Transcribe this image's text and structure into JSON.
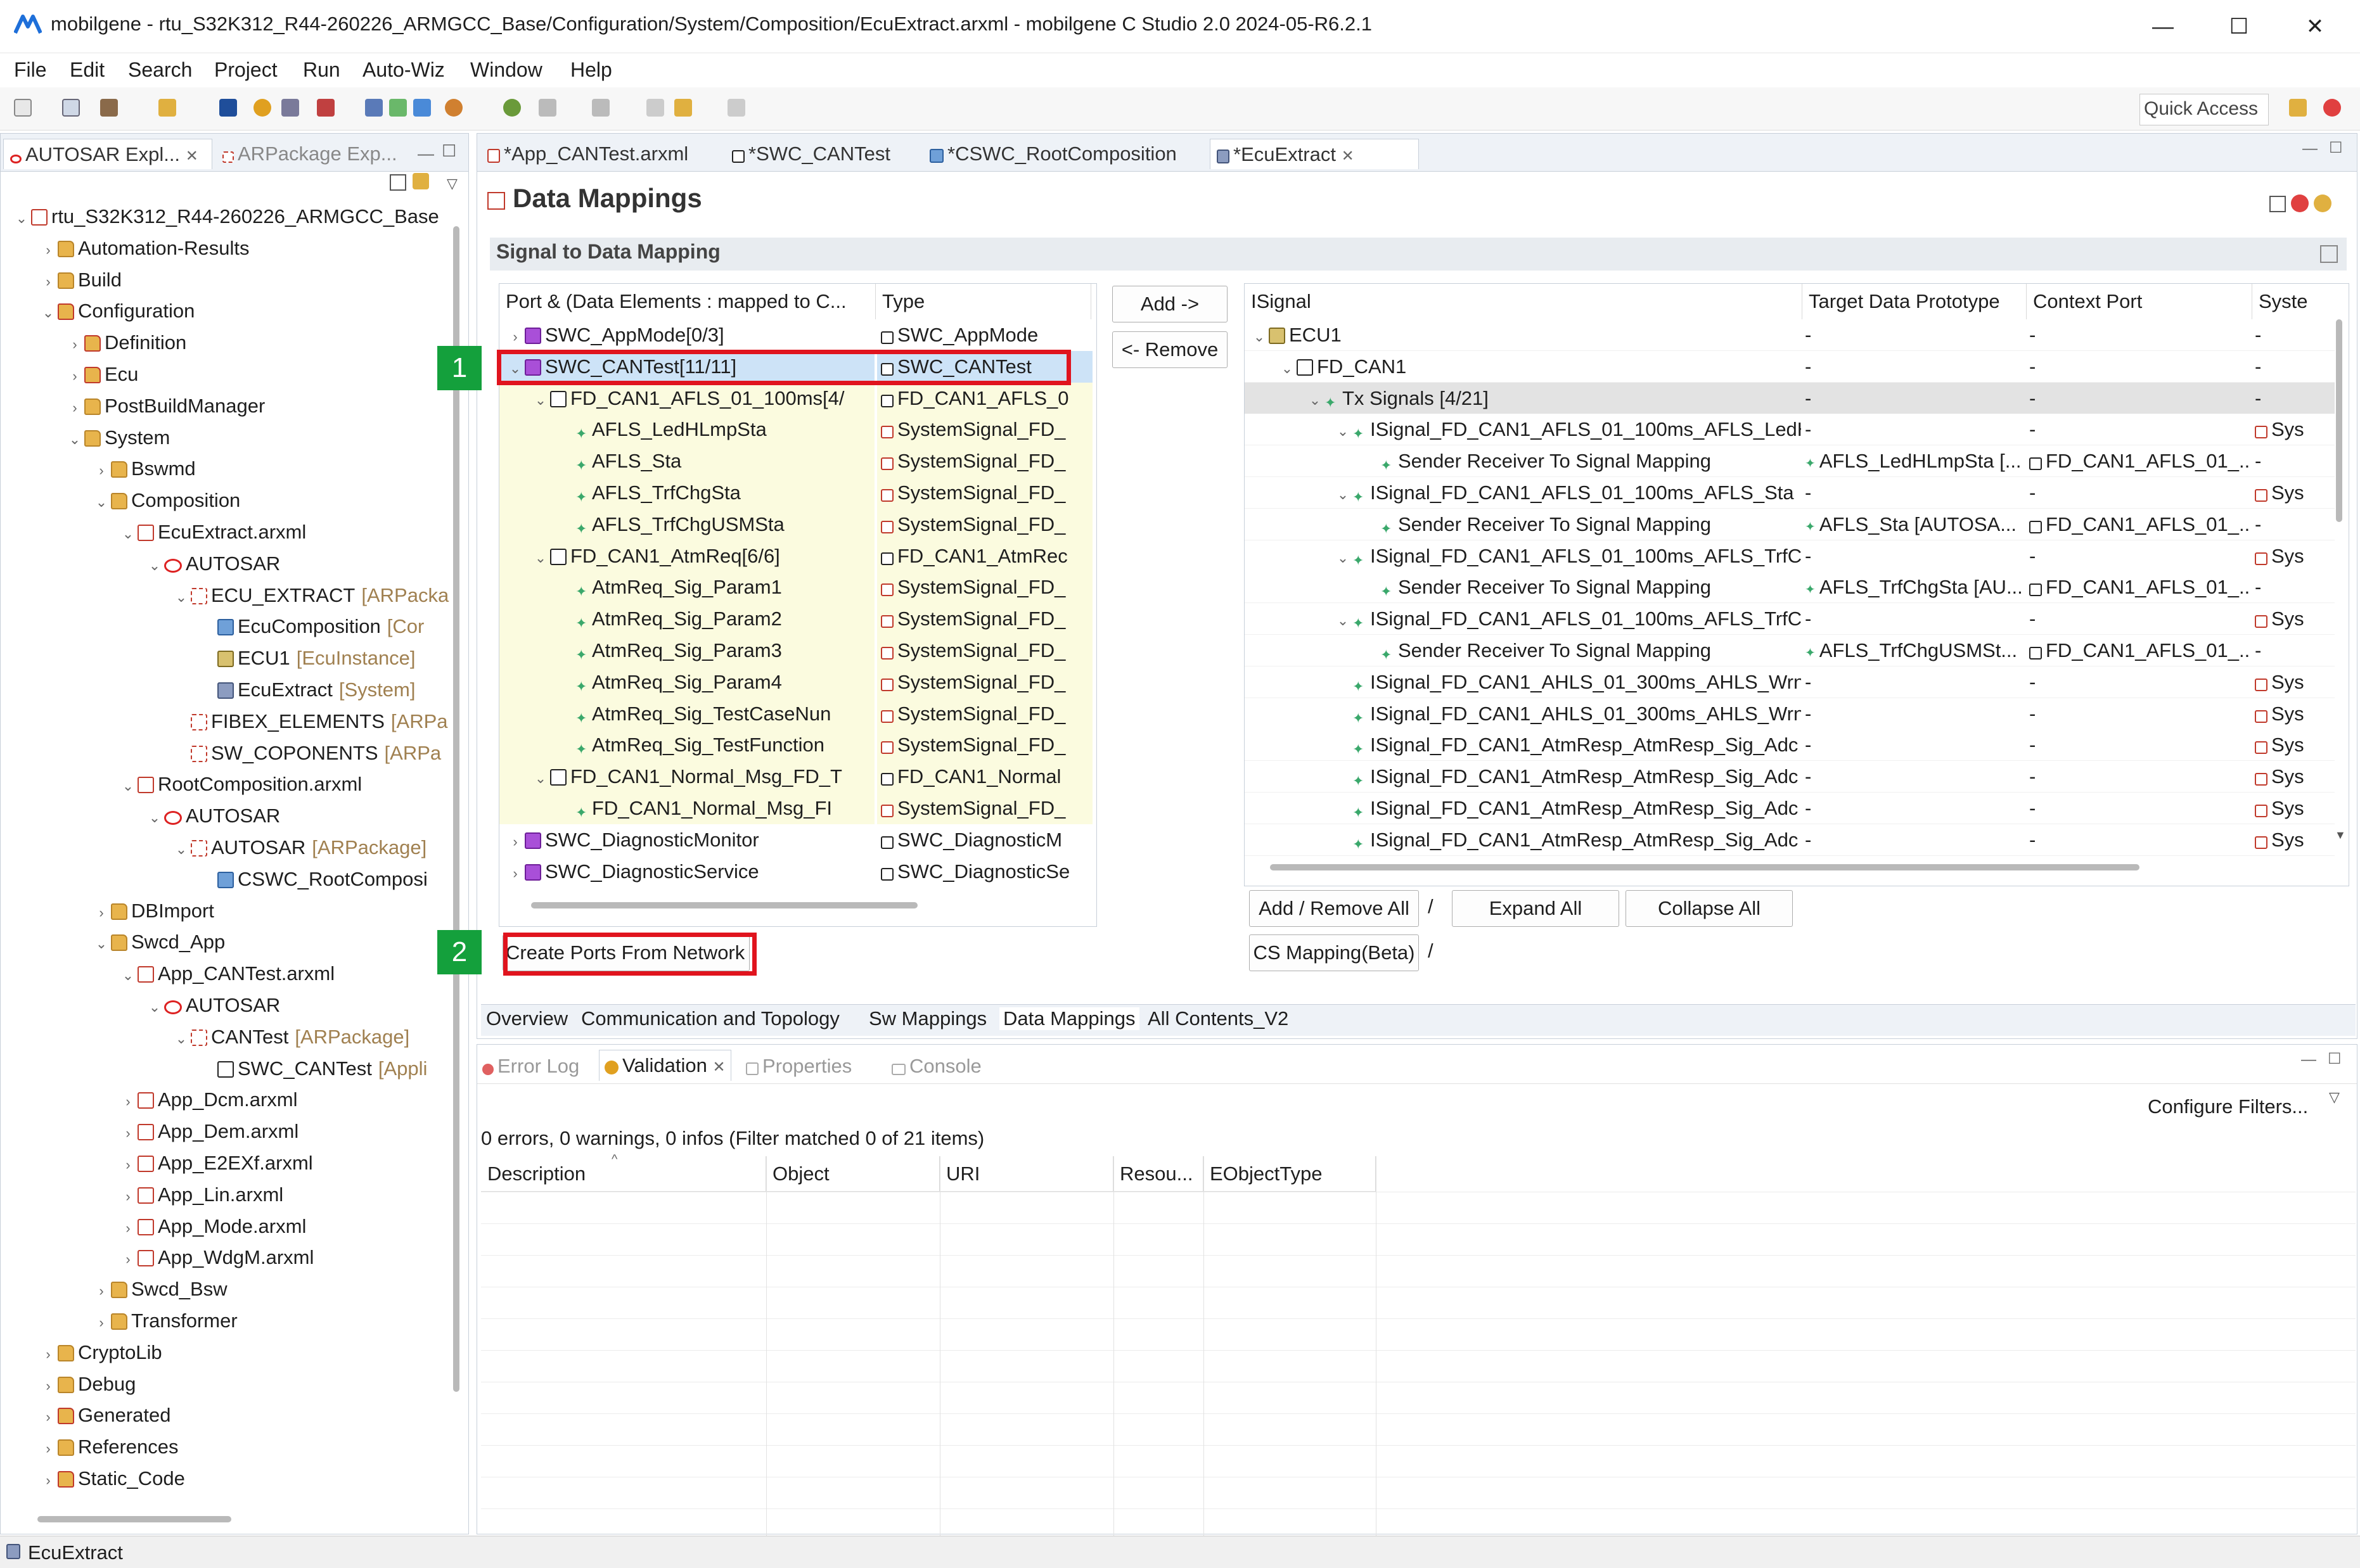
{
  "window": {
    "title": "mobilgene - rtu_S32K312_R44-260226_ARMGCC_Base/Configuration/System/Composition/EcuExtract.arxml - mobilgene C Studio 2.0 2024-05-R6.2.1",
    "minimize": "—",
    "maximize": "☐",
    "close": "✕"
  },
  "menu": [
    "File",
    "Edit",
    "Search",
    "Project",
    "Run",
    "Auto-Wiz",
    "Window",
    "Help"
  ],
  "toolbar": {
    "quick_access": "Quick Access"
  },
  "explorer": {
    "tabs": [
      "AUTOSAR Expl...",
      "ARPackage Exp..."
    ],
    "items": [
      {
        "label": "rtu_S32K312_R44-260226_ARMGCC_Base",
        "suffix": ""
      },
      {
        "label": "Automation-Results",
        "suffix": ""
      },
      {
        "label": "Build",
        "suffix": ""
      },
      {
        "label": "Configuration",
        "suffix": ""
      },
      {
        "label": "Definition",
        "suffix": ""
      },
      {
        "label": "Ecu",
        "suffix": ""
      },
      {
        "label": "PostBuildManager",
        "suffix": ""
      },
      {
        "label": "System",
        "suffix": ""
      },
      {
        "label": "Bswmd",
        "suffix": ""
      },
      {
        "label": "Composition",
        "suffix": ""
      },
      {
        "label": "EcuExtract.arxml",
        "suffix": ""
      },
      {
        "label": "AUTOSAR",
        "suffix": ""
      },
      {
        "label": "ECU_EXTRACT",
        "suffix": "[ARPacka"
      },
      {
        "label": "EcuComposition",
        "suffix": "[Cor"
      },
      {
        "label": "ECU1",
        "suffix": "[EcuInstance]"
      },
      {
        "label": "EcuExtract",
        "suffix": "[System]"
      },
      {
        "label": "FIBEX_ELEMENTS",
        "suffix": "[ARPa"
      },
      {
        "label": "SW_COPONENTS",
        "suffix": "[ARPa"
      },
      {
        "label": "RootComposition.arxml",
        "suffix": ""
      },
      {
        "label": "AUTOSAR",
        "suffix": ""
      },
      {
        "label": "AUTOSAR",
        "suffix": "[ARPackage]"
      },
      {
        "label": "CSWC_RootComposi",
        "suffix": ""
      },
      {
        "label": "DBImport",
        "suffix": ""
      },
      {
        "label": "Swcd_App",
        "suffix": ""
      },
      {
        "label": "App_CANTest.arxml",
        "suffix": ""
      },
      {
        "label": "AUTOSAR",
        "suffix": ""
      },
      {
        "label": "CANTest",
        "suffix": "[ARPackage]"
      },
      {
        "label": "SWC_CANTest",
        "suffix": "[Appli"
      },
      {
        "label": "App_Dcm.arxml",
        "suffix": ""
      },
      {
        "label": "App_Dem.arxml",
        "suffix": ""
      },
      {
        "label": "App_E2EXf.arxml",
        "suffix": ""
      },
      {
        "label": "App_Lin.arxml",
        "suffix": ""
      },
      {
        "label": "App_Mode.arxml",
        "suffix": ""
      },
      {
        "label": "App_WdgM.arxml",
        "suffix": ""
      },
      {
        "label": "Swcd_Bsw",
        "suffix": ""
      },
      {
        "label": "Transformer",
        "suffix": ""
      },
      {
        "label": "CryptoLib",
        "suffix": ""
      },
      {
        "label": "Debug",
        "suffix": ""
      },
      {
        "label": "Generated",
        "suffix": ""
      },
      {
        "label": "References",
        "suffix": ""
      },
      {
        "label": "Static_Code",
        "suffix": ""
      }
    ]
  },
  "editor": {
    "tabs": [
      "*App_CANTest.arxml",
      "*SWC_CANTest",
      "*CSWC_RootComposition",
      "*EcuExtract"
    ],
    "page_title": "Data Mappings",
    "section_title": "Signal to Data Mapping",
    "left_table": {
      "headers": [
        "Port & (Data Elements : mapped to C...",
        "Type"
      ],
      "rows": [
        {
          "name": "SWC_AppMode[0/3]",
          "type": "SWC_AppMode"
        },
        {
          "name": "SWC_CANTest[11/11]",
          "type": "SWC_CANTest"
        },
        {
          "name": "FD_CAN1_AFLS_01_100ms[4/",
          "type": "FD_CAN1_AFLS_0"
        },
        {
          "name": "AFLS_LedHLmpSta",
          "type": "SystemSignal_FD_"
        },
        {
          "name": "AFLS_Sta",
          "type": "SystemSignal_FD_"
        },
        {
          "name": "AFLS_TrfChgSta",
          "type": "SystemSignal_FD_"
        },
        {
          "name": "AFLS_TrfChgUSMSta",
          "type": "SystemSignal_FD_"
        },
        {
          "name": "FD_CAN1_AtmReq[6/6]",
          "type": "FD_CAN1_AtmRec"
        },
        {
          "name": "AtmReq_Sig_Param1",
          "type": "SystemSignal_FD_"
        },
        {
          "name": "AtmReq_Sig_Param2",
          "type": "SystemSignal_FD_"
        },
        {
          "name": "AtmReq_Sig_Param3",
          "type": "SystemSignal_FD_"
        },
        {
          "name": "AtmReq_Sig_Param4",
          "type": "SystemSignal_FD_"
        },
        {
          "name": "AtmReq_Sig_TestCaseNun",
          "type": "SystemSignal_FD_"
        },
        {
          "name": "AtmReq_Sig_TestFunction",
          "type": "SystemSignal_FD_"
        },
        {
          "name": "FD_CAN1_Normal_Msg_FD_T",
          "type": "FD_CAN1_Normal"
        },
        {
          "name": "FD_CAN1_Normal_Msg_FI",
          "type": "SystemSignal_FD_"
        },
        {
          "name": "SWC_DiagnosticMonitor",
          "type": "SWC_DiagnosticM"
        },
        {
          "name": "SWC_DiagnosticService",
          "type": "SWC_DiagnosticSe"
        }
      ]
    },
    "add_label": "Add ->",
    "remove_label": "<- Remove",
    "right_table": {
      "headers": [
        "ISignal",
        "Target Data Prototype",
        "Context Port",
        "Syste"
      ],
      "rows": [
        {
          "name": "ECU1",
          "target": "-",
          "context": "-",
          "sys": "-"
        },
        {
          "name": "FD_CAN1",
          "target": "-",
          "context": "-",
          "sys": "-"
        },
        {
          "name": "Tx Signals [4/21]",
          "target": "-",
          "context": "-",
          "sys": "-"
        },
        {
          "name": "ISignal_FD_CAN1_AFLS_01_100ms_AFLS_LedH",
          "target": "-",
          "context": "-",
          "sys": "Sys"
        },
        {
          "name": "Sender Receiver To Signal Mapping",
          "target": "AFLS_LedHLmpSta [...",
          "context": "FD_CAN1_AFLS_01_...",
          "sys": "-"
        },
        {
          "name": "ISignal_FD_CAN1_AFLS_01_100ms_AFLS_Sta",
          "target": "-",
          "context": "-",
          "sys": "Sys"
        },
        {
          "name": "Sender Receiver To Signal Mapping",
          "target": "AFLS_Sta [AUTOSA...",
          "context": "FD_CAN1_AFLS_01_...",
          "sys": "-"
        },
        {
          "name": "ISignal_FD_CAN1_AFLS_01_100ms_AFLS_TrfCh",
          "target": "-",
          "context": "-",
          "sys": "Sys"
        },
        {
          "name": "Sender Receiver To Signal Mapping",
          "target": "AFLS_TrfChgSta [AU...",
          "context": "FD_CAN1_AFLS_01_...",
          "sys": "-"
        },
        {
          "name": "ISignal_FD_CAN1_AFLS_01_100ms_AFLS_TrfCh",
          "target": "-",
          "context": "-",
          "sys": "Sys"
        },
        {
          "name": "Sender Receiver To Signal Mapping",
          "target": "AFLS_TrfChgUSMSt...",
          "context": "FD_CAN1_AFLS_01_...",
          "sys": "-"
        },
        {
          "name": "ISignal_FD_CAN1_AHLS_01_300ms_AHLS_Wrn",
          "target": "-",
          "context": "-",
          "sys": "Sys"
        },
        {
          "name": "ISignal_FD_CAN1_AHLS_01_300ms_AHLS_Wrn",
          "target": "-",
          "context": "-",
          "sys": "Sys"
        },
        {
          "name": "ISignal_FD_CAN1_AtmResp_AtmResp_Sig_Adc",
          "target": "-",
          "context": "-",
          "sys": "Sys"
        },
        {
          "name": "ISignal_FD_CAN1_AtmResp_AtmResp_Sig_Adc",
          "target": "-",
          "context": "-",
          "sys": "Sys"
        },
        {
          "name": "ISignal_FD_CAN1_AtmResp_AtmResp_Sig_Adc",
          "target": "-",
          "context": "-",
          "sys": "Sys"
        },
        {
          "name": "ISignal_FD_CAN1_AtmResp_AtmResp_Sig_Adc",
          "target": "-",
          "context": "-",
          "sys": "Sys"
        }
      ]
    },
    "add_remove_all": "Add / Remove All",
    "expand_all": "Expand All",
    "collapse_all": "Collapse All",
    "cs_mapping": "CS Mapping(Beta)",
    "slash": "/",
    "create_ports": "Create Ports From Network",
    "bottom_tabs": [
      "Overview",
      "Communication and Topology",
      "Sw Mappings",
      "Data Mappings",
      "All Contents_V2"
    ]
  },
  "annotations": {
    "badge1": "1",
    "badge2": "2"
  },
  "validation": {
    "tabs": [
      "Error Log",
      "Validation",
      "Properties",
      "Console"
    ],
    "configure": "Configure Filters...",
    "summary": "0 errors, 0 warnings, 0 infos (Filter matched 0 of 21 items)",
    "headers": [
      "Description",
      "Object",
      "URI",
      "Resou...",
      "EObjectType"
    ]
  },
  "status": {
    "text": "EcuExtract"
  }
}
